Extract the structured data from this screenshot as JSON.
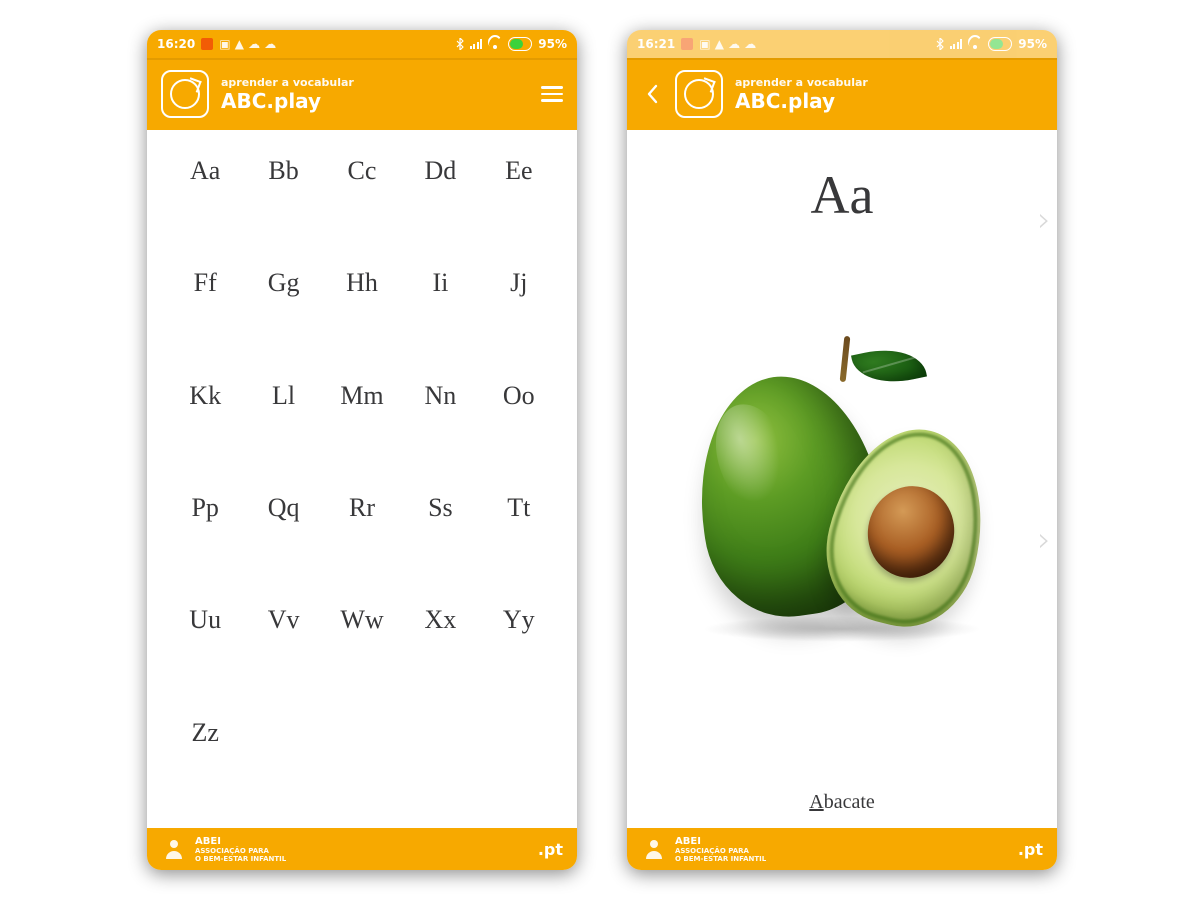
{
  "app": {
    "subtitle": "aprender a vocabular",
    "title": "ABC.play"
  },
  "status_left": {
    "time": "16:20",
    "battery": "95%"
  },
  "status_right": {
    "time": "16:21",
    "battery": "95%"
  },
  "letters": [
    "Aa",
    "Bb",
    "Cc",
    "Dd",
    "Ee",
    "Ff",
    "Gg",
    "Hh",
    "Ii",
    "Jj",
    "Kk",
    "Ll",
    "Mm",
    "Nn",
    "Oo",
    "Pp",
    "Qq",
    "Rr",
    "Ss",
    "Tt",
    "Uu",
    "Vv",
    "Ww",
    "Xx",
    "Yy",
    "Zz"
  ],
  "detail": {
    "letter": "Aa",
    "word_first": "A",
    "word_rest": "bacate",
    "image_semantic": "avocado"
  },
  "footer": {
    "org_short": "ABEI",
    "org_line2": "ASSOCIAÇÃO PARA",
    "org_line3": "O BEM-ESTAR INFANTIL",
    "tld": ".pt"
  },
  "nav_glyph": "›"
}
